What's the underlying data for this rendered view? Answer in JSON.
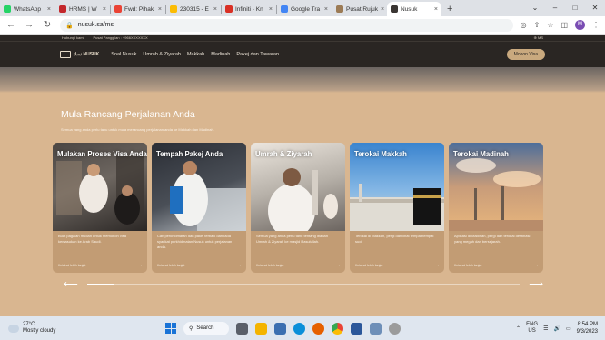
{
  "browser": {
    "tabs": [
      {
        "label": "WhatsApp",
        "color": "#25d366",
        "active": false
      },
      {
        "label": "HRMS | W",
        "color": "#c3272b",
        "active": false
      },
      {
        "label": "Fwd: Pihak",
        "color": "#ea4335",
        "active": false
      },
      {
        "label": "230315 - E",
        "color": "#fbbc04",
        "active": false
      },
      {
        "label": "Infiniti - Kn",
        "color": "#d93025",
        "active": false
      },
      {
        "label": "Google Tra",
        "color": "#4285f4",
        "active": false
      },
      {
        "label": "Pusat Rujuk",
        "color": "#9c7b55",
        "active": false
      },
      {
        "label": "Nusuk",
        "color": "#3a3633",
        "active": true
      }
    ],
    "url": "nusuk.sa/ms",
    "profile_initial": "M"
  },
  "site": {
    "topstrip": {
      "item1": "Hubungi kami",
      "item2": "Pusat Panggilan : +966XXXXXXX",
      "lang": "⊕ MS"
    },
    "logo_text": "نسك NUSUK",
    "nav": [
      "Soal Nusuk",
      "Umrah & Ziyarah",
      "Makkah",
      "Madinah",
      "Pakej dan Tawaran"
    ],
    "visa_button": "Mohon Visa"
  },
  "main": {
    "heading": "Mula Rancang Perjalanan Anda",
    "subheading": "Semua yang anda perlu tahu untuk mula merancang perjalanan anda ke Makkah dan Madinah.",
    "cards": [
      {
        "title": "Mulakan Proses Visa Anda",
        "desc": "Buat pagaian mudah untuk memohon visa kemasukan ke Arab Saudi.",
        "more": "Ketahui lebih lanjut"
      },
      {
        "title": "Tempah Pakej Anda",
        "desc": "Cari perkhidmatan dan pakej terbaik daripada syarikat perkhidmatan Nusuk untuk perjalanan anda.",
        "more": "Ketahui lebih lanjut"
      },
      {
        "title": "Umrah & Ziyarah",
        "desc": "Semua yang anda perlu tahu tentang ibadah Umrah & Ziyarah ke masjid Rasulullah.",
        "more": "Ketahui lebih lanjut"
      },
      {
        "title": "Terokai Makkah",
        "desc": "Terokai di Makkah, pergi dan lihat tempat-tempat suci.",
        "more": "Ketahui lebih lanjut"
      },
      {
        "title": "Terokai Madinah",
        "desc": "Aplikasi di Madinah, pergi dan terokai destinasi yang megah dan bersejarah.",
        "more": "Ketahui lebih lanjut"
      }
    ],
    "arrow_icon": "arrow-icon",
    "carousel_progress": 0.0
  },
  "taskbar": {
    "temp": "27°C",
    "weather": "Mostly cloudy",
    "search_label": "Search",
    "lang_line1": "ENG",
    "lang_line2": "US",
    "time": "8:54 PM",
    "date": "9/3/2023"
  }
}
